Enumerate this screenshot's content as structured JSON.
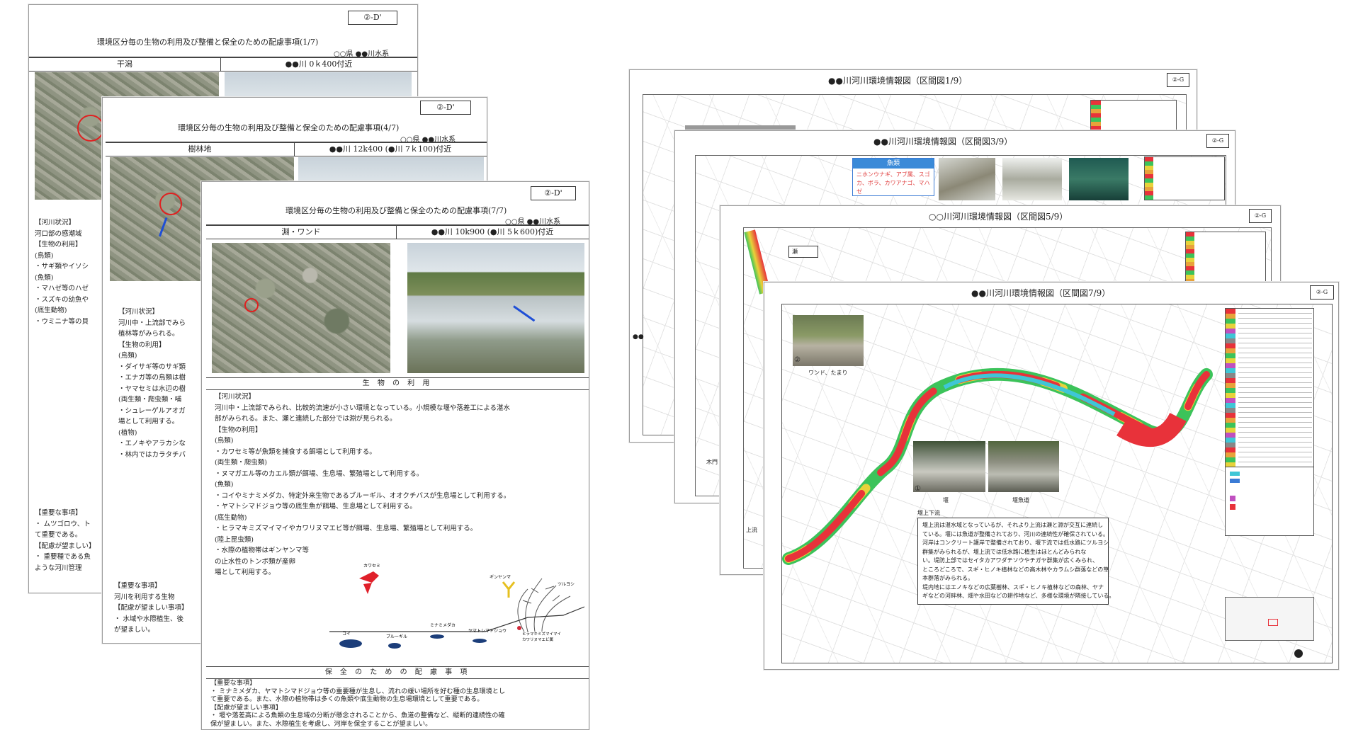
{
  "left_doc_1": {
    "badge": "②-D'",
    "title": "環境区分毎の生物の利用及び整備と保全のための配慮事項(1/7)",
    "region": "○○県 ●●川水系",
    "col_a": "干潟",
    "col_b": "●●川 0ｋ400付近",
    "lines": [
      "【河川状況】",
      "河口部の感潮域",
      "【生物の利用】",
      "(鳥類)",
      "・サギ類やイソシ",
      "(魚類)",
      "・マハゼ等のハゼ",
      "・スズキの幼魚や",
      "(底生動物)",
      "・ウミニナ等の貝"
    ],
    "lines2": [
      "【重要な事項】",
      "・ ムツゴロウ、ト",
      "て重要である。",
      "【配慮が望ましい】",
      "・ 重要種である魚",
      "ような河川管理"
    ]
  },
  "left_doc_2": {
    "badge": "②-D'",
    "title": "環境区分毎の生物の利用及び整備と保全のための配慮事項(4/7)",
    "region": "○○県 ●●川水系",
    "col_a": "樹林地",
    "col_b": "●●川 12k400 (●川 7ｋ100)付近",
    "lines": [
      "【河川状況】",
      "河川中・上流部でみら",
      "植林等がみられる。",
      "【生物の利用】",
      "(鳥類)",
      "・ダイサギ等のサギ類",
      "・エナガ等の鳥類は樹",
      "・ヤマセミは水辺の樹",
      "(両生類・爬虫類・哺",
      "・シュレーゲルアオガ",
      "場として利用する。",
      "(植物)",
      "・エノキやアラカシな",
      "・林内ではカラタチバ"
    ],
    "lines2": [
      "【重要な事項】",
      "河川を利用する生物",
      "【配慮が望ましい事項】",
      "・ 水域や水際植生、後",
      "が望ましい。"
    ]
  },
  "left_doc_3": {
    "badge": "②-D'",
    "title": "環境区分毎の生物の利用及び整備と保全のための配慮事項(7/7)",
    "region": "○○県 ●●川水系",
    "col_a": "淵・ワンド",
    "col_b": "●●川 10k900 (●川 5ｋ600)付近",
    "section_use": "生 物 の 利 用",
    "lines": [
      "【河川状況】",
      "河川中・上流部でみられ、比較的流速が小さい環境となっている。小規模な堰や落差工による湛水",
      "部がみられる。また、瀬と連続した部分では淵が見られる。",
      "【生物の利用】",
      "(鳥類)",
      "・カワセミ等が魚類を捕食する餌場として利用する。",
      "(両生類・爬虫類)",
      "・ヌマガエル等のカエル類が餌場、生息場、繁殖場として利用する。",
      "(魚類)",
      "・コイやミナミメダカ、特定外来生物であるブルーギル、オオクチバスが生息場として利用する。",
      "・ヤマトシマドジョウ等の底生魚が餌場、生息場として利用する。",
      "(底生動物)",
      "・ヒラマキミズマイマイやカワリヌマエビ等が餌場、生息場、繁殖場として利用する。",
      "(陸上昆虫類)",
      "・水際の植物帯はギンヤンマ等",
      "の止水性のトンボ類が産卵",
      "場として利用する。"
    ],
    "section_cons": "保 全 の た め の 配 慮 事 項",
    "lines2": [
      "【重要な事項】",
      "・ ミナミメダカ、ヤマトシマドジョウ等の重要種が生息し、流れの緩い場所を好む種の生息環境とし",
      "て重要である。また、水際の植物帯は多くの魚類や底生動物の生息場環境として重要である。",
      "【配慮が望ましい事項】",
      "・ 堰や落差高による魚類の生息域の分断が懸念されることから、魚道の整備など、縦断的連続性の確",
      "保が望ましい。また、水際植生を考慮し、河岸を保全することが望ましい。"
    ],
    "illus_labels": {
      "bird": "カワセミ",
      "dragonfly": "ギンヤンマ",
      "reed": "ツルヨシ",
      "fish1": "コイ",
      "fish2": "ブルーギル",
      "fish3": "ミナミメダカ",
      "fish4": "ヤマトシマドジョウ",
      "snail1": "ヒラマキミズマイマイ",
      "snail2": "カワリヌマエビ属"
    }
  },
  "map_1": {
    "title": "●●川河川環境情報図（区間図1/9）",
    "badge": "②-G",
    "side_label": "●●"
  },
  "map_2": {
    "title": "●●川河川環境情報図（区間図3/9）",
    "badge": "②-G",
    "fish_header": "魚類",
    "fish_text": "ニホンウナギ、アブ属、スゴカ、ボラ、カワアナゴ、マハゼ",
    "side_label": "木門"
  },
  "map_3": {
    "title": "○○川河川環境情報図（区間図5/9）",
    "badge": "②-G",
    "box_label": "瀬",
    "side_label": "上流"
  },
  "map_4": {
    "title": "●●川河川環境情報図（区間図7/9）",
    "badge": "②-G",
    "photo1_num": "②",
    "photo1_cap": "ワンド、たまり",
    "photo2_num": "①",
    "photo2_cap": "堰",
    "photo3_cap": "堰魚道",
    "note_title": "堰上下流",
    "note_lines": [
      "堰上流は湛水域となっているが、それより上流は瀬と淵が交互に連続し",
      "ている。堰には魚道が整備されており、河川の連続性が確保されている。",
      "河岸はコンクリート護岸で整備されており、堰下流では低水路にツルヨシ",
      "群集がみられるが、堰上流では低水路に植生はほとんどみられな",
      "い。堤防上部ではセイタカアワダチソウやチガヤ群集が広くみられ、",
      "ところどころで、スギ・ヒノキ植林などの高木林やカラムシ群落などの草",
      "本群落がみられる。",
      "堤内地にはエノキなどの広葉樹林、スギ・ヒノキ植林などの森林、ヤナ",
      "ギなどの河畔林、畑や水田などの耕作地など、多様な環境が隣接している。"
    ],
    "colors": {
      "river_red": "#e8323a",
      "river_cyan": "#3fc6d6",
      "river_green": "#3cc35a",
      "river_yellow": "#e8d23a"
    }
  }
}
